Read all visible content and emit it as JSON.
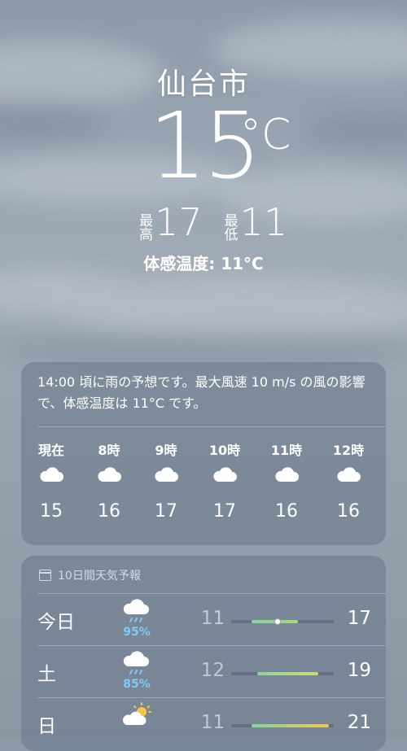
{
  "location": {
    "city": "仙台市"
  },
  "current": {
    "temperature": "15",
    "unit": "°C",
    "high_label": "最高",
    "high": "17",
    "low_label": "最低",
    "low": "11",
    "feels_like": "体感温度: 11°C"
  },
  "hourly": {
    "summary": "14:00 頃に雨の予想です。最大風速 10 m/s の風の影響で、体感温度は 11°C です。",
    "items": [
      {
        "label": "現在",
        "icon": "cloud-icon",
        "temp": "15"
      },
      {
        "label": "8時",
        "icon": "cloud-icon",
        "temp": "16"
      },
      {
        "label": "9時",
        "icon": "cloud-icon",
        "temp": "17"
      },
      {
        "label": "10時",
        "icon": "cloud-icon",
        "temp": "17"
      },
      {
        "label": "11時",
        "icon": "cloud-icon",
        "temp": "16"
      },
      {
        "label": "12時",
        "icon": "cloud-icon",
        "temp": "16"
      }
    ]
  },
  "forecast": {
    "title": "10日間天気予報",
    "days": [
      {
        "day": "今日",
        "icon": "cloud-rain-icon",
        "precip": "95%",
        "low": "11",
        "high": "17",
        "bar_start": 0.2,
        "bar_end": 0.65,
        "current_marker": 0.45,
        "bar_colors": [
          "#86d6a0",
          "#a8d880"
        ]
      },
      {
        "day": "土",
        "icon": "cloud-rain-icon",
        "precip": "85%",
        "low": "12",
        "high": "19",
        "bar_start": 0.25,
        "bar_end": 0.85,
        "bar_colors": [
          "#86d6a0",
          "#d6dc6a"
        ]
      },
      {
        "day": "日",
        "icon": "sun-cloud-icon",
        "precip": "",
        "low": "11",
        "high": "21",
        "bar_start": 0.2,
        "bar_end": 0.95,
        "bar_colors": [
          "#86d6a0",
          "#f0c84a"
        ]
      }
    ]
  },
  "colors": {
    "precip": "#7ecbf5",
    "card": "rgba(105,120,140,0.58)"
  }
}
